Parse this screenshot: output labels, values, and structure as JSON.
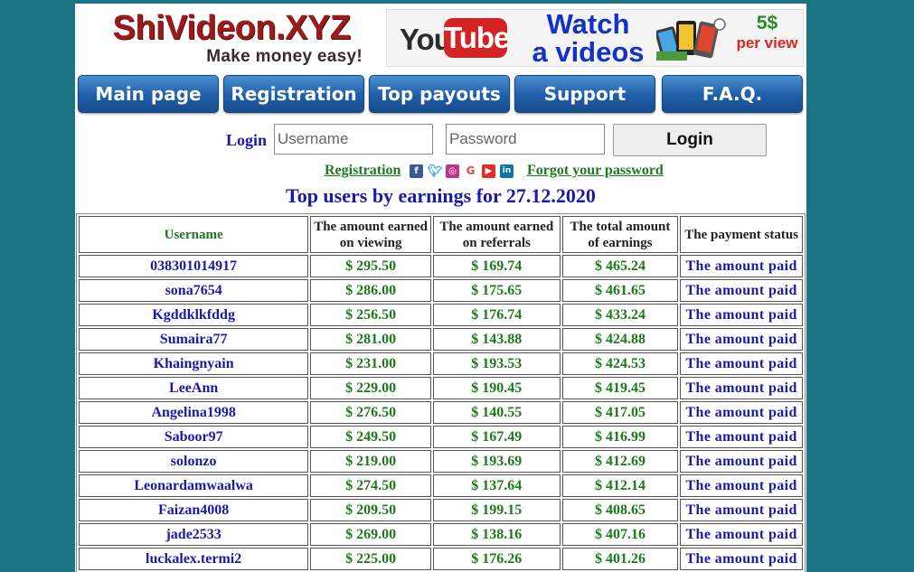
{
  "header": {
    "logo_title": "ShiVideon.XYZ",
    "logo_slogan": "Make money easy!",
    "banner": {
      "you": "You",
      "tube": "Tube",
      "watch_line1": "Watch",
      "watch_line2": "a videos",
      "price": "5$",
      "per_view": "per view"
    }
  },
  "nav": {
    "items": [
      {
        "label": "Main page"
      },
      {
        "label": "Registration"
      },
      {
        "label": "Top payouts"
      },
      {
        "label": "Support"
      },
      {
        "label": "F.A.Q."
      }
    ]
  },
  "login": {
    "label": "Login",
    "username_placeholder": "Username",
    "password_placeholder": "Password",
    "button_label": "Login",
    "registration_link": "Registration",
    "forgot_link": "Forgot your password",
    "social_icons": [
      "facebook-icon",
      "twitter-icon",
      "instagram-icon",
      "google-icon",
      "youtube-icon",
      "linkedin-icon"
    ]
  },
  "colors": {
    "background": "#1b7384",
    "nav_button": "#1f5ea8",
    "link_blue": "#1a1aa8",
    "money_green": "#1c7a1c",
    "logo_red": "#9b1b1b"
  },
  "leaderboard": {
    "title": "Top users by earnings for 27.12.2020",
    "columns": [
      "Username",
      "The amount earned on viewing",
      "The amount earned on referrals",
      "The total amount of earnings",
      "The payment status"
    ],
    "rows": [
      {
        "username": "038301014917",
        "viewing": "$ 295.50",
        "referrals": "$ 169.74",
        "total": "$ 465.24",
        "status": "The amount paid"
      },
      {
        "username": "sona7654",
        "viewing": "$ 286.00",
        "referrals": "$ 175.65",
        "total": "$ 461.65",
        "status": "The amount paid"
      },
      {
        "username": "Kgddklkfddg",
        "viewing": "$ 256.50",
        "referrals": "$ 176.74",
        "total": "$ 433.24",
        "status": "The amount paid"
      },
      {
        "username": "Sumaira77",
        "viewing": "$ 281.00",
        "referrals": "$ 143.88",
        "total": "$ 424.88",
        "status": "The amount paid"
      },
      {
        "username": "Khaingnyain",
        "viewing": "$ 231.00",
        "referrals": "$ 193.53",
        "total": "$ 424.53",
        "status": "The amount paid"
      },
      {
        "username": "LeeAnn",
        "viewing": "$ 229.00",
        "referrals": "$ 190.45",
        "total": "$ 419.45",
        "status": "The amount paid"
      },
      {
        "username": "Angelina1998",
        "viewing": "$ 276.50",
        "referrals": "$ 140.55",
        "total": "$ 417.05",
        "status": "The amount paid"
      },
      {
        "username": "Saboor97",
        "viewing": "$ 249.50",
        "referrals": "$ 167.49",
        "total": "$ 416.99",
        "status": "The amount paid"
      },
      {
        "username": "solonzo",
        "viewing": "$ 219.00",
        "referrals": "$ 193.69",
        "total": "$ 412.69",
        "status": "The amount paid"
      },
      {
        "username": "Leonardamwaalwa",
        "viewing": "$ 274.50",
        "referrals": "$ 137.64",
        "total": "$ 412.14",
        "status": "The amount paid"
      },
      {
        "username": "Faizan4008",
        "viewing": "$ 209.50",
        "referrals": "$ 199.15",
        "total": "$ 408.65",
        "status": "The amount paid"
      },
      {
        "username": "jade2533",
        "viewing": "$ 269.00",
        "referrals": "$ 138.16",
        "total": "$ 407.16",
        "status": "The amount paid"
      },
      {
        "username": "luckalex.termi2",
        "viewing": "$ 225.00",
        "referrals": "$ 176.26",
        "total": "$ 401.26",
        "status": "The amount paid"
      }
    ]
  }
}
